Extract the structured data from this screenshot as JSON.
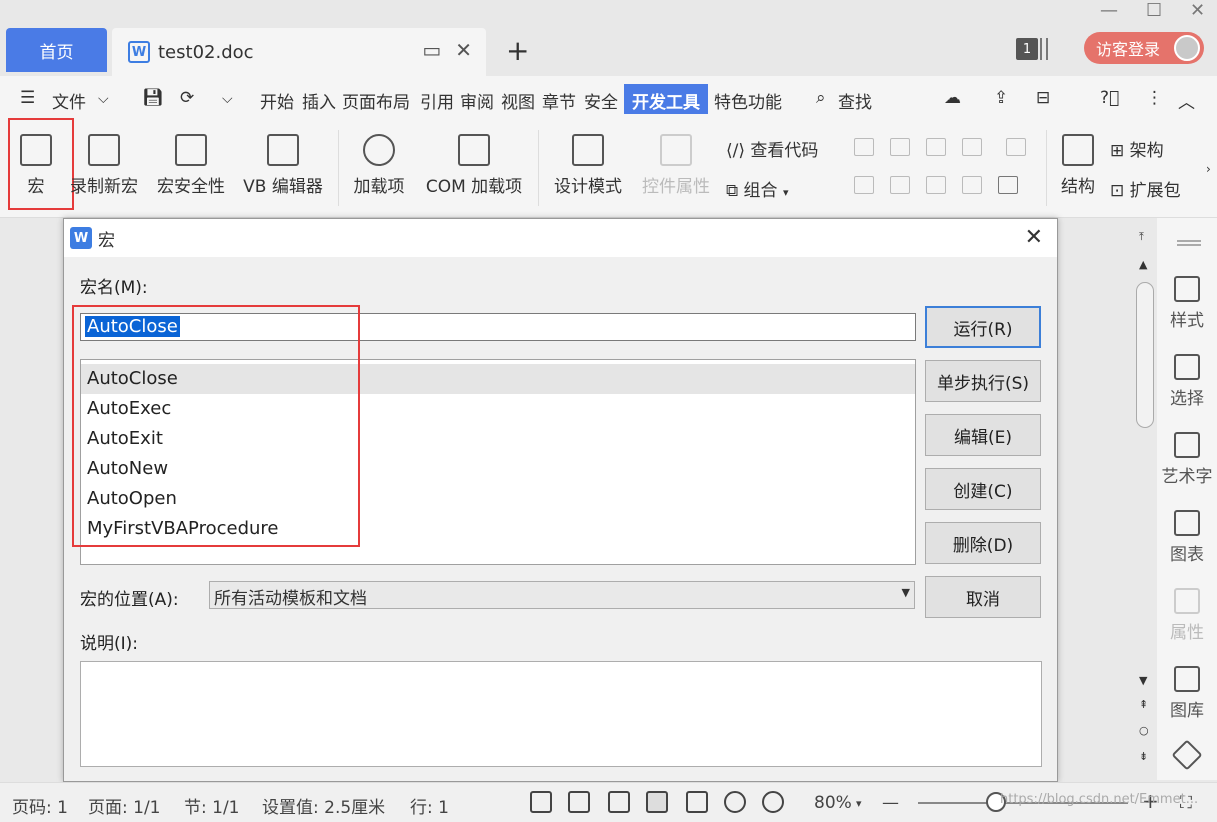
{
  "titlebar": {
    "home_tab": "首页",
    "doc_tab_icon": "W",
    "doc_tab": "test02.doc",
    "badge": "1",
    "login": "访客登录"
  },
  "menubar": {
    "file": "文件",
    "items": [
      "开始",
      "插入",
      "页面布局",
      "引用",
      "审阅",
      "视图",
      "章节",
      "安全",
      "开发工具",
      "特色功能"
    ],
    "search": "查找"
  },
  "ribbon": {
    "macro": "宏",
    "record": "录制新宏",
    "security": "宏安全性",
    "vb_editor": "VB 编辑器",
    "addins": "加载项",
    "com_addins": "COM 加载项",
    "design_mode": "设计模式",
    "control_props": "控件属性",
    "view_code": "查看代码",
    "group": "组合",
    "structure": "结构",
    "schema": "架构",
    "expansion": "扩展包"
  },
  "sidepanel": {
    "items": [
      "样式",
      "选择",
      "艺术字",
      "图表",
      "属性",
      "图库"
    ]
  },
  "dialog": {
    "title_icon": "W",
    "title": "宏",
    "name_label": "宏名(M):",
    "name_value": "AutoClose",
    "macros": [
      "AutoClose",
      "AutoExec",
      "AutoExit",
      "AutoNew",
      "AutoOpen",
      "MyFirstVBAProcedure"
    ],
    "buttons": {
      "run": "运行(R)",
      "step": "单步执行(S)",
      "edit": "编辑(E)",
      "create": "创建(C)",
      "delete": "删除(D)",
      "cancel": "取消"
    },
    "location_label": "宏的位置(A):",
    "location_value": "所有活动模板和文档",
    "desc_label": "说明(I):"
  },
  "statusbar": {
    "page_num": "页码: 1",
    "page": "页面: 1/1",
    "section": "节: 1/1",
    "setting": "设置值: 2.5厘米",
    "row": "行: 1",
    "zoom": "80%",
    "watermark": "https://blog.csdn.net/Emmet..."
  },
  "colors": {
    "accent": "#4a7be6",
    "login": "#e5736b",
    "highlight_box": "#e53b3b",
    "selection": "#0a64d6"
  }
}
